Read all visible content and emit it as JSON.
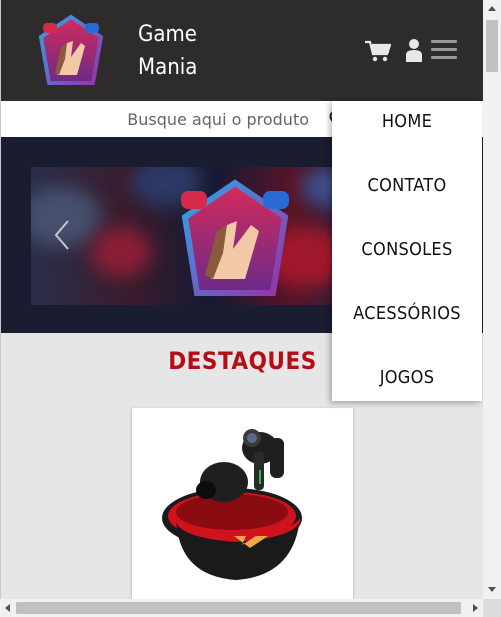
{
  "header": {
    "brand_line1": "Game",
    "brand_line2": "Mania",
    "icons": [
      "logo-icon",
      "cart-icon",
      "user-icon",
      "menu-icon"
    ]
  },
  "search": {
    "placeholder": "Busque aqui o produto",
    "icon": "search-icon"
  },
  "nav": {
    "items": [
      {
        "label": "HOME"
      },
      {
        "label": "CONTATO"
      },
      {
        "label": "CONSOLES"
      },
      {
        "label": "ACESSÓRIOS"
      },
      {
        "label": "JOGOS"
      }
    ]
  },
  "carousel": {
    "prev_icon": "chevron-left-icon"
  },
  "section": {
    "title": "DESTAQUES"
  },
  "colors": {
    "header_bg": "#2e2c2a",
    "accent_red": "#b50d15",
    "page_bg": "#e6e6e6"
  }
}
